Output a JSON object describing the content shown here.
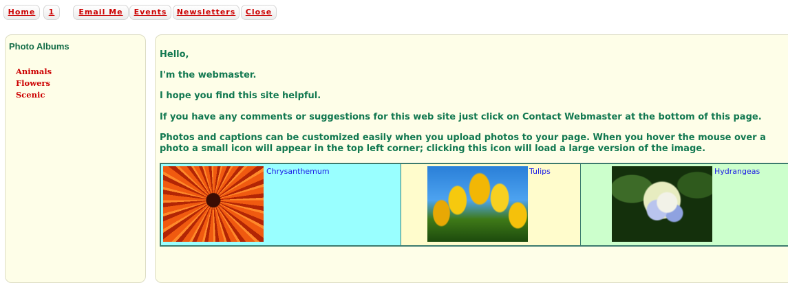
{
  "nav": {
    "items": [
      "Home",
      "1",
      "Email Me",
      "Events",
      "Newsletters",
      "Close"
    ]
  },
  "sidebar": {
    "title": "Photo Albums",
    "albums": [
      "Animals",
      "Flowers",
      "Scenic"
    ]
  },
  "main": {
    "paragraphs": [
      "Hello,",
      "I'm the webmaster.",
      "I hope you find this site helpful.",
      "If you have any comments or suggestions for this web site just click on Contact Webmaster at the bottom of this page.",
      "Photos and captions can be customized easily when you upload photos to your page. When you hover the mouse over a photo a small icon will appear in the top left corner; clicking this icon will load a large version of the image."
    ],
    "photos": [
      {
        "caption": "Chrysanthemum",
        "background": "#99ffff",
        "icon": "chrysanthemum-photo"
      },
      {
        "caption": "Tulips",
        "background": "#fffccc",
        "icon": "tulips-photo"
      },
      {
        "caption": "Hydrangeas",
        "background": "#ccffcc",
        "icon": "hydrangeas-photo"
      }
    ]
  },
  "colors": {
    "nav_link": "#cc0000",
    "heading": "#116b46",
    "body_text": "#117850",
    "album_link": "#cc0000",
    "caption_link": "#1a1ae6",
    "panel_bg": "#fefee8"
  }
}
